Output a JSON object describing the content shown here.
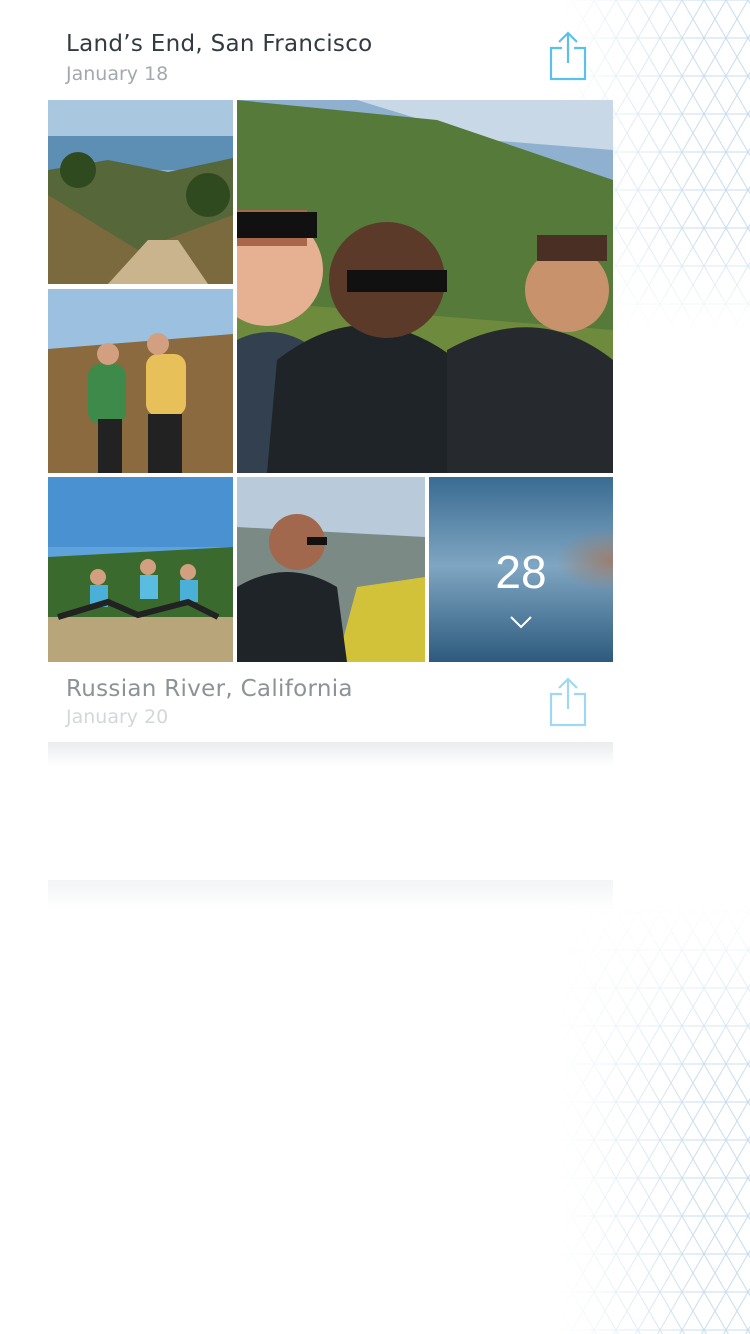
{
  "sections": [
    {
      "title": "Land’s End, San Francisco",
      "date": "January 18",
      "share_icon": "share-icon",
      "more_count": "28",
      "more_icon": "chevron-down-icon"
    },
    {
      "title": "Russian River, California",
      "date": "January 20",
      "share_icon": "share-icon"
    }
  ],
  "colors": {
    "accent": "#5bc0eb",
    "title_text": "#333a40",
    "date_text": "#a4a9ad",
    "pattern": "#c9dced"
  }
}
